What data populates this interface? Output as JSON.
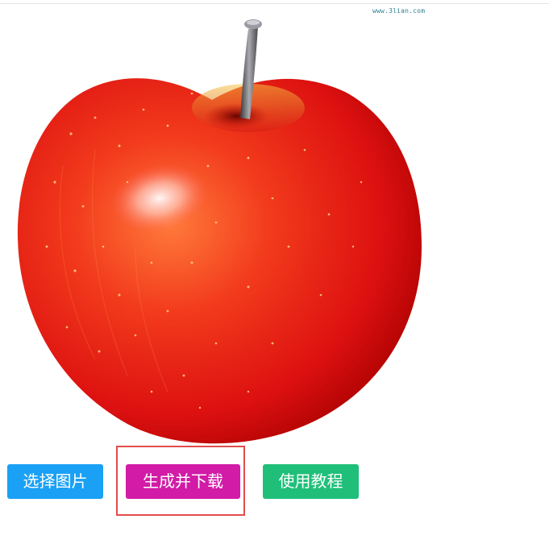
{
  "image": {
    "subject": "apple",
    "watermark": "www.3lian.com"
  },
  "buttons": {
    "select_image": "选择图片",
    "generate_download": "生成并下载",
    "tutorial": "使用教程"
  },
  "colors": {
    "select_button": "#1aa1f5",
    "generate_button": "#d21ba6",
    "tutorial_button": "#1fbf7a",
    "highlight_border": "#e24c4c"
  }
}
